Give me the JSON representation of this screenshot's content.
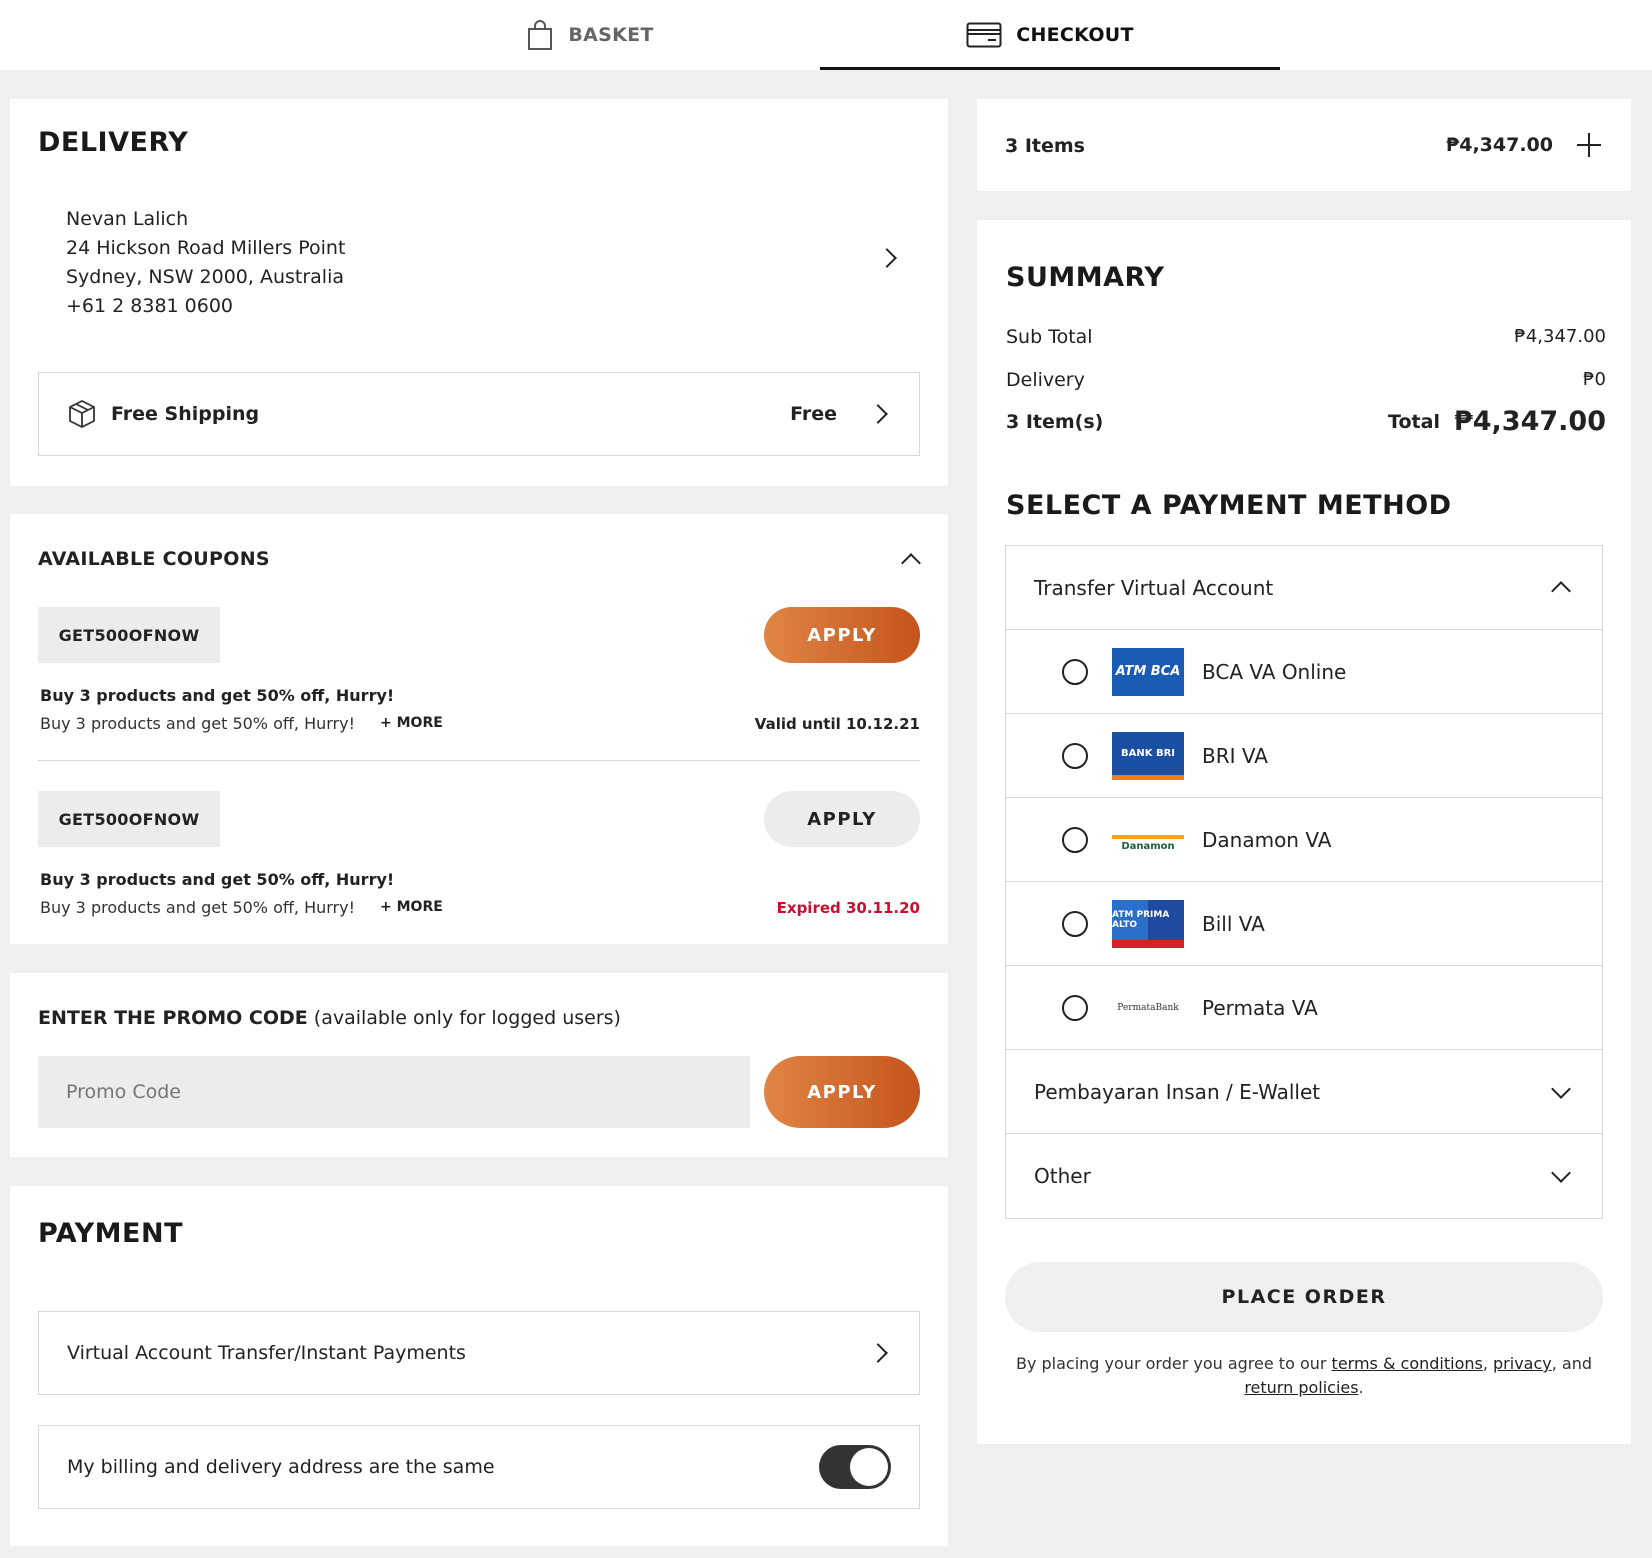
{
  "tabs": {
    "basket": "BASKET",
    "checkout": "CHECKOUT"
  },
  "delivery": {
    "title": "DELIVERY",
    "name": "Nevan Lalich",
    "address1": "24 Hickson Road Millers Point",
    "address2": "Sydney, NSW 2000, Australia",
    "phone": "+61 2 8381 0600",
    "shipping_label": "Free Shipping",
    "shipping_price": "Free"
  },
  "coupons": {
    "title": "AVAILABLE COUPONS",
    "items": [
      {
        "code": "GET500OFNOW",
        "apply": "APPLY",
        "title": "Buy 3 products and get 50% off, Hurry!",
        "desc": "Buy 3 products and get 50% off, Hurry!",
        "more": "+ MORE",
        "validity": "Valid until 10.12.21"
      },
      {
        "code": "GET500OFNOW",
        "apply": "APPLY",
        "title": "Buy 3 products and get 50% off, Hurry!",
        "desc": "Buy 3 products and get 50% off, Hurry!",
        "more": "+ MORE",
        "validity": "Expired 30.11.20"
      }
    ]
  },
  "promo": {
    "title_bold": "ENTER THE PROMO CODE",
    "title_rest": " (available only for logged users)",
    "placeholder": "Promo Code",
    "apply": "APPLY"
  },
  "payment": {
    "title": "PAYMENT",
    "method": "Virtual Account Transfer/Instant Payments",
    "billing_label": "My billing and delivery address are the same"
  },
  "cart": {
    "items_label": "3 Items",
    "amount": "₱4,347.00"
  },
  "summary": {
    "title": "SUMMARY",
    "subtotal_label": "Sub Total",
    "subtotal_value": "₱4,347.00",
    "delivery_label": "Delivery",
    "delivery_value": "₱0",
    "count_label": "3 Item(s)",
    "total_label": "Total",
    "total_value": "₱4,347.00"
  },
  "payment_method": {
    "title": "SELECT A PAYMENT METHOD",
    "group_open": "Transfer Virtual Account",
    "options": [
      {
        "label": "BCA VA Online",
        "logo": "ATM BCA"
      },
      {
        "label": "BRI VA",
        "logo": "BANK BRI"
      },
      {
        "label": "Danamon VA",
        "logo": "Danamon"
      },
      {
        "label": "Bill VA",
        "logo": "ATM PRIMA ALTO"
      },
      {
        "label": "Permata VA",
        "logo": "PermataBank"
      }
    ],
    "group_ewallet": "Pembayaran Insan / E-Wallet",
    "group_other": "Other"
  },
  "order": {
    "place_order": "PLACE ORDER",
    "terms_prefix": "By placing your order you agree to our ",
    "terms_link": "terms & conditions",
    "comma": ", ",
    "privacy_link": "privacy",
    "and": ", and ",
    "return_link": "return policies",
    "period": "."
  },
  "colors": {
    "accent_start": "#e08545",
    "accent_end": "#c5541c",
    "expired": "#c8102e"
  }
}
